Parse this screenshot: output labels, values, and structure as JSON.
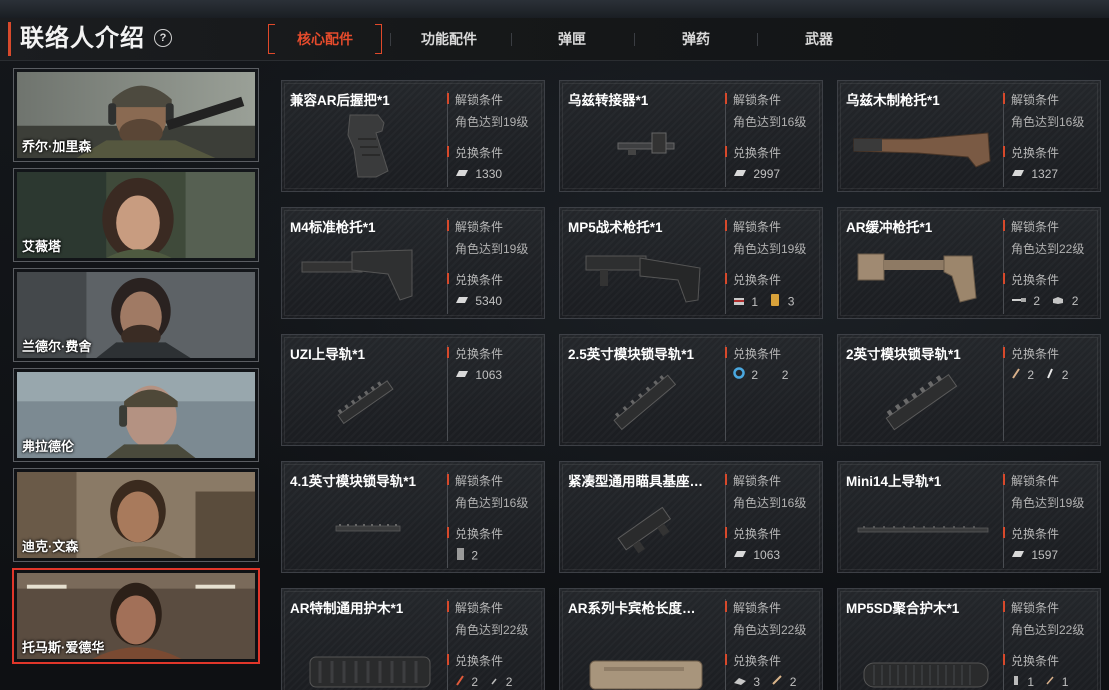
{
  "header": {
    "title": "联络人介绍",
    "help_glyph": "?",
    "tabs": [
      {
        "label": "核心配件",
        "active": true
      },
      {
        "label": "功能配件",
        "active": false
      },
      {
        "label": "弹匣",
        "active": false
      },
      {
        "label": "弹药",
        "active": false
      },
      {
        "label": "武器",
        "active": false
      }
    ]
  },
  "characters": [
    {
      "name": "乔尔·加里森",
      "selected": false
    },
    {
      "name": "艾薇塔",
      "selected": false
    },
    {
      "name": "兰德尔·费舍",
      "selected": false
    },
    {
      "name": "弗拉德伦",
      "selected": false
    },
    {
      "name": "迪克·文森",
      "selected": false
    },
    {
      "name": "托马斯·爱德华",
      "selected": true
    }
  ],
  "labels": {
    "unlock": "解锁条件",
    "exchange": "兑换条件"
  },
  "items": [
    {
      "title": "兼容AR后握把*1",
      "unlock": "角色达到19级",
      "costs": [
        {
          "icon": "ingot-icon",
          "value": "1330"
        }
      ]
    },
    {
      "title": "乌兹转接器*1",
      "unlock": "角色达到16级",
      "costs": [
        {
          "icon": "ingot-icon",
          "value": "2997"
        }
      ]
    },
    {
      "title": "乌兹木制枪托*1",
      "unlock": "角色达到16级",
      "costs": [
        {
          "icon": "ingot-icon",
          "value": "1327"
        }
      ]
    },
    {
      "title": "M4标准枪托*1",
      "unlock": "角色达到19级",
      "costs": [
        {
          "icon": "ingot-icon",
          "value": "5340"
        }
      ]
    },
    {
      "title": "MP5战术枪托*1",
      "unlock": "角色达到19级",
      "costs": [
        {
          "icon": "card-icon",
          "value": "1"
        },
        {
          "icon": "gold-bar-icon",
          "value": "3"
        }
      ]
    },
    {
      "title": "AR缓冲枪托*1",
      "unlock": "角色达到22级",
      "costs": [
        {
          "icon": "barrel-part-icon",
          "value": "2"
        },
        {
          "icon": "block-icon",
          "value": "2"
        }
      ]
    },
    {
      "title": "UZI上导轨*1",
      "unlock": null,
      "costs": [
        {
          "icon": "ingot-icon",
          "value": "1063"
        }
      ]
    },
    {
      "title": "2.5英寸模块锁导轨*1",
      "unlock": null,
      "costs": [
        {
          "icon": "ring-icon",
          "value": "2"
        },
        {
          "icon": "blank-icon",
          "value": "2"
        }
      ]
    },
    {
      "title": "2英寸模块锁导轨*1",
      "unlock": null,
      "costs": [
        {
          "icon": "pin-icon",
          "value": "2"
        },
        {
          "icon": "stick-icon",
          "value": "2"
        }
      ]
    },
    {
      "title": "4.1英寸模块锁导轨*1",
      "unlock": "角色达到16级",
      "costs": [
        {
          "icon": "plate-icon",
          "value": "2"
        }
      ]
    },
    {
      "title": "紧凑型通用瞄具基座…",
      "unlock": "角色达到16级",
      "costs": [
        {
          "icon": "ingot-icon",
          "value": "1063"
        }
      ]
    },
    {
      "title": "Mini14上导轨*1",
      "unlock": "角色达到19级",
      "costs": [
        {
          "icon": "ingot-icon",
          "value": "1597"
        }
      ]
    },
    {
      "title": "AR特制通用护木*1",
      "unlock": "角色达到22级",
      "costs": [
        {
          "icon": "feather-icon",
          "value": "2"
        },
        {
          "icon": "slash-icon",
          "value": "2"
        }
      ]
    },
    {
      "title": "AR系列卡宾枪长度…",
      "unlock": "角色达到22级",
      "costs": [
        {
          "icon": "clip-icon",
          "value": "3"
        },
        {
          "icon": "hook-icon",
          "value": "2"
        }
      ]
    },
    {
      "title": "MP5SD聚合护木*1",
      "unlock": "角色达到22级",
      "costs": [
        {
          "icon": "tube-icon",
          "value": "1"
        },
        {
          "icon": "wire-icon",
          "value": "1"
        }
      ]
    }
  ],
  "colors": {
    "accent": "#e0492a",
    "background": "#0f1114",
    "card": "#202327"
  }
}
